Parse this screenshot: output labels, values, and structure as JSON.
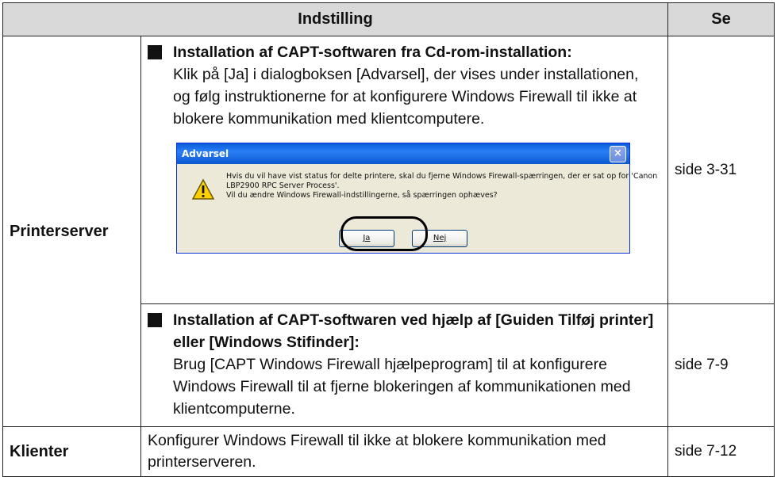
{
  "table": {
    "header_setting": "Indstilling",
    "header_see": "Se"
  },
  "printer_server": {
    "label": "Printerserver",
    "row1": {
      "heading": "Installation af CAPT-softwaren fra Cd-rom-installation:",
      "body": "Klik på [Ja] i dialogboksen [Advarsel], der vises under installationen, og følg instruktionerne for at konfigurere Windows Firewall til ikke at blokere kommunikation med klientcomputere.",
      "ref": "side 3-31"
    },
    "dialog": {
      "title": "Advarsel",
      "close": "×",
      "icon": "warning-icon",
      "line1": "Hvis du vil have vist status for delte printere, skal du fjerne Windows Firewall-spærringen, der er sat op for 'Canon",
      "line2": "LBP2900 RPC Server Process'.",
      "line3": "Vil du ændre Windows Firewall-indstillingerne, så spærringen ophæves?",
      "yes": "Ja",
      "no": "Nej"
    },
    "row2": {
      "heading": "Installation af CAPT-softwaren ved hjælp af [Guiden Tilføj printer] eller [Windows Stifinder]:",
      "body": "Brug [CAPT Windows Firewall hjælpeprogram] til at konfigurere Windows Firewall til at fjerne blokeringen af kommunikationen med klientcomputerne.",
      "ref": "side 7-9"
    }
  },
  "clients": {
    "label": "Klienter",
    "body": "Konfigurer Windows Firewall til ikke at blokere kommunikation med printerserveren.",
    "ref": "side 7-12"
  }
}
